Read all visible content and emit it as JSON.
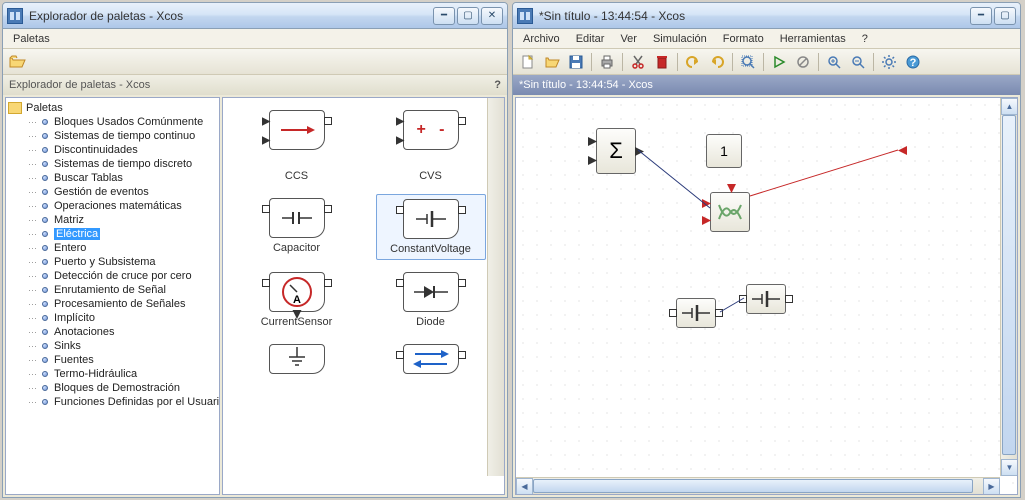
{
  "left_window": {
    "title": "Explorador de paletas - Xcos",
    "menu": {
      "palettes": "Paletas"
    },
    "subheader": "Explorador de paletas - Xcos",
    "help_mark": "?",
    "tree": {
      "root": "Paletas",
      "items": [
        "Bloques Usados Comúnmente",
        "Sistemas de tiempo continuo",
        "Discontinuidades",
        "Sistemas de tiempo discreto",
        "Buscar Tablas",
        "Gestión de eventos",
        "Operaciones matemáticas",
        "Matriz",
        "Eléctrica",
        "Entero",
        "Puerto y Subsistema",
        "Detección de cruce por cero",
        "Enrutamiento de Señal",
        "Procesamiento de Señales",
        "Implícito",
        "Anotaciones",
        "Sinks",
        "Fuentes",
        "Termo-Hidráulica",
        "Bloques de Demostración",
        "Funciones Definidas por el Usuario"
      ],
      "selected_index": 8
    },
    "palette_items": [
      {
        "label": ""
      },
      {
        "label": ""
      },
      {
        "label": "CCS"
      },
      {
        "label": "CVS"
      },
      {
        "label": "Capacitor"
      },
      {
        "label": "ConstantVoltage",
        "selected": true
      },
      {
        "label": "CurrentSensor"
      },
      {
        "label": "Diode"
      },
      {
        "label": ""
      },
      {
        "label": ""
      }
    ]
  },
  "right_window": {
    "title": "*Sin título - 13:44:54 - Xcos",
    "subheader": "*Sin título - 13:44:54 - Xcos",
    "menu": {
      "archivo": "Archivo",
      "editar": "Editar",
      "ver": "Ver",
      "simulacion": "Simulación",
      "formato": "Formato",
      "herramientas": "Herramientas",
      "help": "?"
    },
    "canvas_blocks": {
      "sum": "Σ",
      "const": "1"
    }
  }
}
